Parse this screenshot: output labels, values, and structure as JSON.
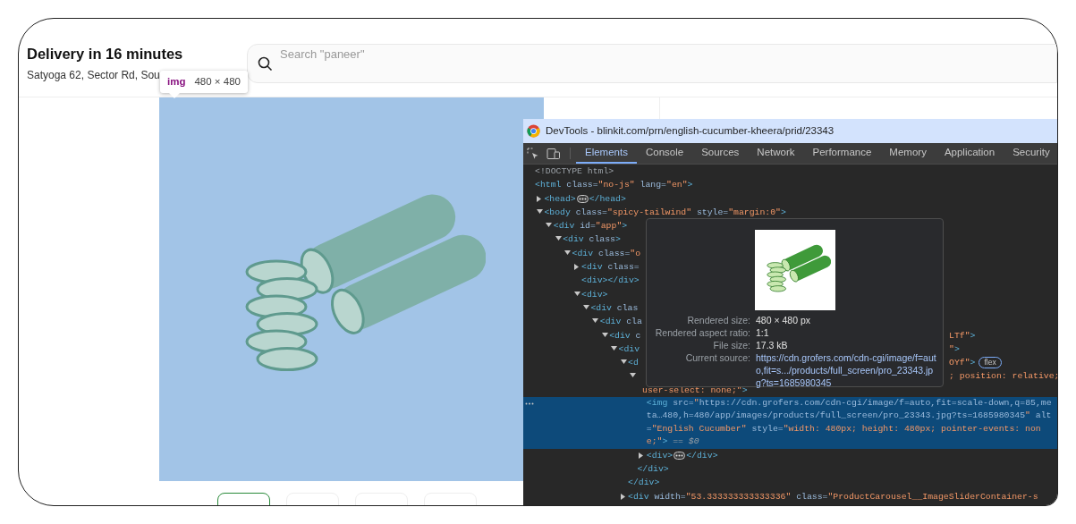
{
  "page": {
    "delivery_title": "Delivery in 16 minutes",
    "address": "Satyoga 62, Sector Rd, Sou",
    "search": {
      "placeholder": "Search \"paneer\""
    },
    "thumbnails": [
      {
        "selected": true
      },
      {
        "selected": false
      },
      {
        "selected": false
      },
      {
        "selected": false
      }
    ]
  },
  "element_badge": {
    "tag": "img",
    "size": "480 × 480"
  },
  "devtools": {
    "title": "DevTools - blinkit.com/prn/english-cucumber-kheera/prid/23343",
    "tabs": [
      {
        "label": "Elements",
        "selected": true
      },
      {
        "label": "Console",
        "selected": false
      },
      {
        "label": "Sources",
        "selected": false
      },
      {
        "label": "Network",
        "selected": false
      },
      {
        "label": "Performance",
        "selected": false
      },
      {
        "label": "Memory",
        "selected": false
      },
      {
        "label": "Application",
        "selected": false
      },
      {
        "label": "Security",
        "selected": false
      }
    ],
    "tree": [
      {
        "kind": "doctype",
        "open": "<!DOCTYPE html>",
        "selected": false
      },
      {
        "kind": "element",
        "open": "<html class=\"no-js\" lang=\"en\">",
        "selected": false,
        "children": [
          {
            "kind": "element",
            "open": "<head>",
            "expanded": false,
            "close": "</head>",
            "selected": false
          },
          {
            "kind": "element",
            "open": "<body class=\"spicy-tailwind\" style=\"margin:0\">",
            "expanded": true,
            "selected": false,
            "children": [
              {
                "kind": "element",
                "open": "<div id=\"app\">",
                "expanded": true,
                "selected": false,
                "children": [
                  {
                    "kind": "element",
                    "open": "<div class>",
                    "expanded": true,
                    "selected": false,
                    "children": [
                      {
                        "kind": "element",
                        "open": "<div class=\"o",
                        "expanded": true,
                        "selected": false,
                        "children": [
                          {
                            "kind": "element",
                            "open": "<div class=",
                            "expanded": false,
                            "selected": false
                          },
                          {
                            "kind": "element",
                            "open": "<div></div>",
                            "selected": false
                          },
                          {
                            "kind": "element",
                            "open": "<div>",
                            "expanded": true,
                            "selected": false,
                            "children": [
                              {
                                "kind": "element",
                                "open": "<div clas",
                                "expanded": true,
                                "selected": false,
                                "children": [
                                  {
                                    "kind": "element",
                                    "open": "<div cla",
                                    "expanded": true,
                                    "selected": false,
                                    "children": [
                                      {
                                        "kind": "element",
                                        "open": "<div c",
                                        "right": "LTf\">",
                                        "expanded": true,
                                        "selected": false,
                                        "children": [
                                          {
                                            "kind": "element",
                                            "open": "<div",
                                            "right": "\">",
                                            "expanded": true,
                                            "selected": false,
                                            "children": [
                                              {
                                                "kind": "element",
                                                "open": "<d",
                                                "right": "OYf\">",
                                                "badge": "flex",
                                                "expanded": true,
                                                "selected": false,
                                                "children": [
                                                  {
                                                    "kind": "element",
                                                    "right": "; position: relative;",
                                                    "continuation": "user-select: none;\">",
                                                    "expanded": true,
                                                    "selected": false,
                                                    "close": "</div>",
                                                    "children": [
                                                      {
                                                        "kind": "img",
                                                        "selected": true,
                                                        "before": "<img src=\"",
                                                        "link": "https://cdn.grofers.com/cdn-cgi/image/f=auto,fit=scale-down,q=85,meta…480,h=480/app/images/products/full_screen/pro_23343.jpg?ts=1685980345",
                                                        "after": "\" alt=\"English Cucumber\" style=\"width: 480px; height: 480px; pointer-events: none;\">",
                                                        "note": "== $0"
                                                      },
                                                      {
                                                        "kind": "element",
                                                        "open": "<div>",
                                                        "expanded": false,
                                                        "close": "</div>",
                                                        "selected": false
                                                      }
                                                    ]
                                                  }
                                                ],
                                                "close": "</div>"
                                              },
                                              {
                                                "kind": "element",
                                                "open": "<div width=\"53.333333333333336\" class=\"ProductCarousel__ImageSliderContainer-s",
                                                "expanded": false,
                                                "selected": false
                                              }
                                            ]
                                          }
                                        ]
                                      }
                                    ]
                                  }
                                ]
                              }
                            ]
                          }
                        ]
                      }
                    ]
                  }
                ]
              }
            ]
          }
        ]
      }
    ],
    "tooltip": {
      "rows": [
        {
          "kind": "text",
          "label": "Rendered size:",
          "value": "480 × 480 px"
        },
        {
          "kind": "text",
          "label": "Rendered aspect ratio:",
          "value": "1:1"
        },
        {
          "kind": "text",
          "label": "File size:",
          "value": "17.3 kB"
        },
        {
          "kind": "link",
          "label": "Current source:",
          "value": "https://cdn.grofers.com/cdn-cgi/image/f=auto,fit=s.../products/full_screen/pro_23343.jpg?ts=1685980345"
        }
      ]
    }
  }
}
